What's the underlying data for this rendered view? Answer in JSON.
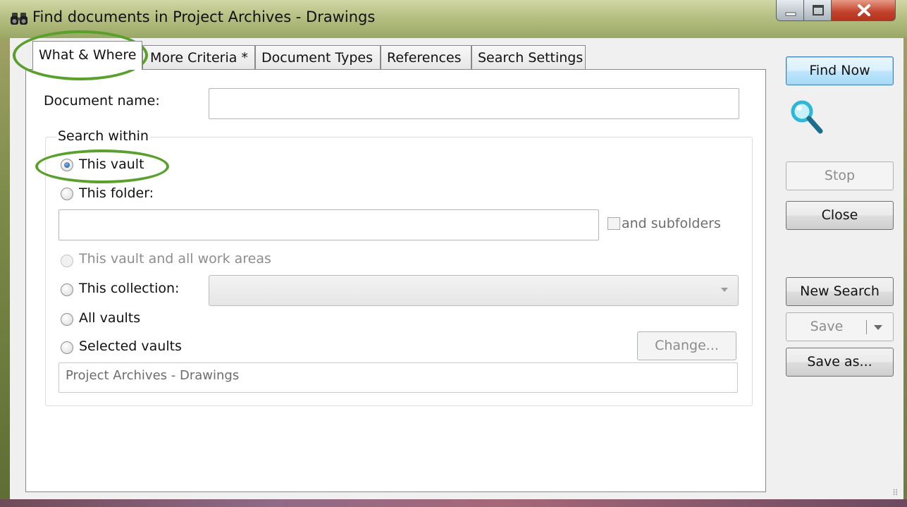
{
  "window": {
    "title": "Find documents in Project Archives - Drawings",
    "icon": "binoculars-icon"
  },
  "tabs": [
    {
      "label": "What & Where",
      "active": true
    },
    {
      "label": "More Criteria *"
    },
    {
      "label": "Document Types"
    },
    {
      "label": "References"
    },
    {
      "label": "Search Settings"
    }
  ],
  "form": {
    "document_name_label": "Document name:",
    "document_name_value": "",
    "search_within_label": "Search within",
    "options": {
      "this_vault": "This vault",
      "this_folder": "This folder:",
      "and_subfolders": "and subfolders",
      "vault_and_work_areas": "This vault and all work areas",
      "this_collection": "This collection:",
      "all_vaults": "All vaults",
      "selected_vaults": "Selected vaults"
    },
    "selected_option": "This vault",
    "folder_value": "",
    "collection_value": "",
    "selected_vaults_value": "Project Archives - Drawings"
  },
  "buttons": {
    "find_now": "Find Now",
    "stop": "Stop",
    "close": "Close",
    "new_search": "New Search",
    "save": "Save",
    "save_as": "Save as...",
    "change": "Change..."
  },
  "colors": {
    "highlight_ellipse": "#5aa02c",
    "magnifier": "#2fb7d6"
  }
}
